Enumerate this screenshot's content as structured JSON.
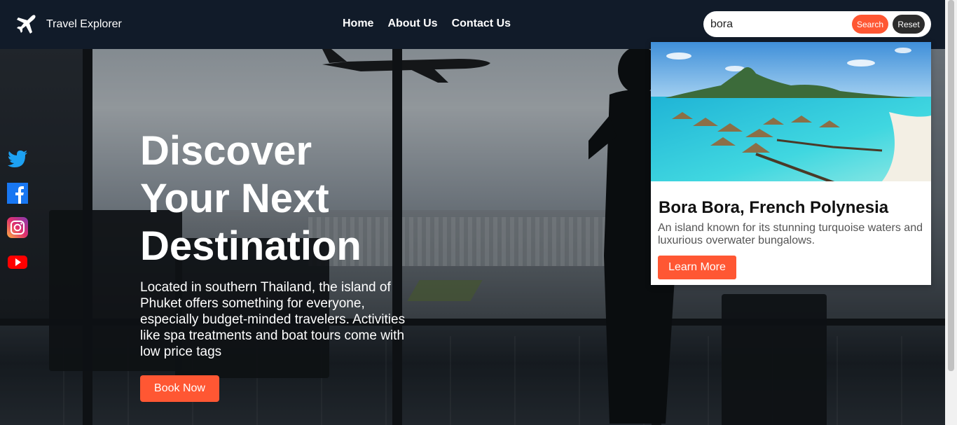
{
  "brand": {
    "name": "Travel Explorer",
    "icon": "airplane-icon"
  },
  "nav": {
    "links": [
      {
        "label": "Home"
      },
      {
        "label": "About Us"
      },
      {
        "label": "Contact Us"
      }
    ]
  },
  "search": {
    "value": "bora",
    "placeholder": "",
    "search_label": "Search",
    "reset_label": "Reset"
  },
  "social": [
    {
      "name": "twitter-icon",
      "color": "#1da1f2"
    },
    {
      "name": "facebook-icon",
      "color": "#1877f2"
    },
    {
      "name": "instagram-icon",
      "color": "#e1306c"
    },
    {
      "name": "youtube-icon",
      "color": "#ff0000"
    }
  ],
  "hero": {
    "title": "Discover Your Next Destination",
    "description": "Located in southern Thailand, the island of Phuket offers something for everyone, especially budget-minded travelers. Activities like spa treatments and boat tours come with low price tags",
    "button_label": "Book Now"
  },
  "result": {
    "title": "Bora Bora, French Polynesia",
    "description": "An island known for its stunning turquoise waters and luxurious overwater bungalows.",
    "button_label": "Learn More"
  },
  "colors": {
    "accent": "#ff5733",
    "navbar": "#111b29",
    "reset": "#2c2c2c"
  }
}
